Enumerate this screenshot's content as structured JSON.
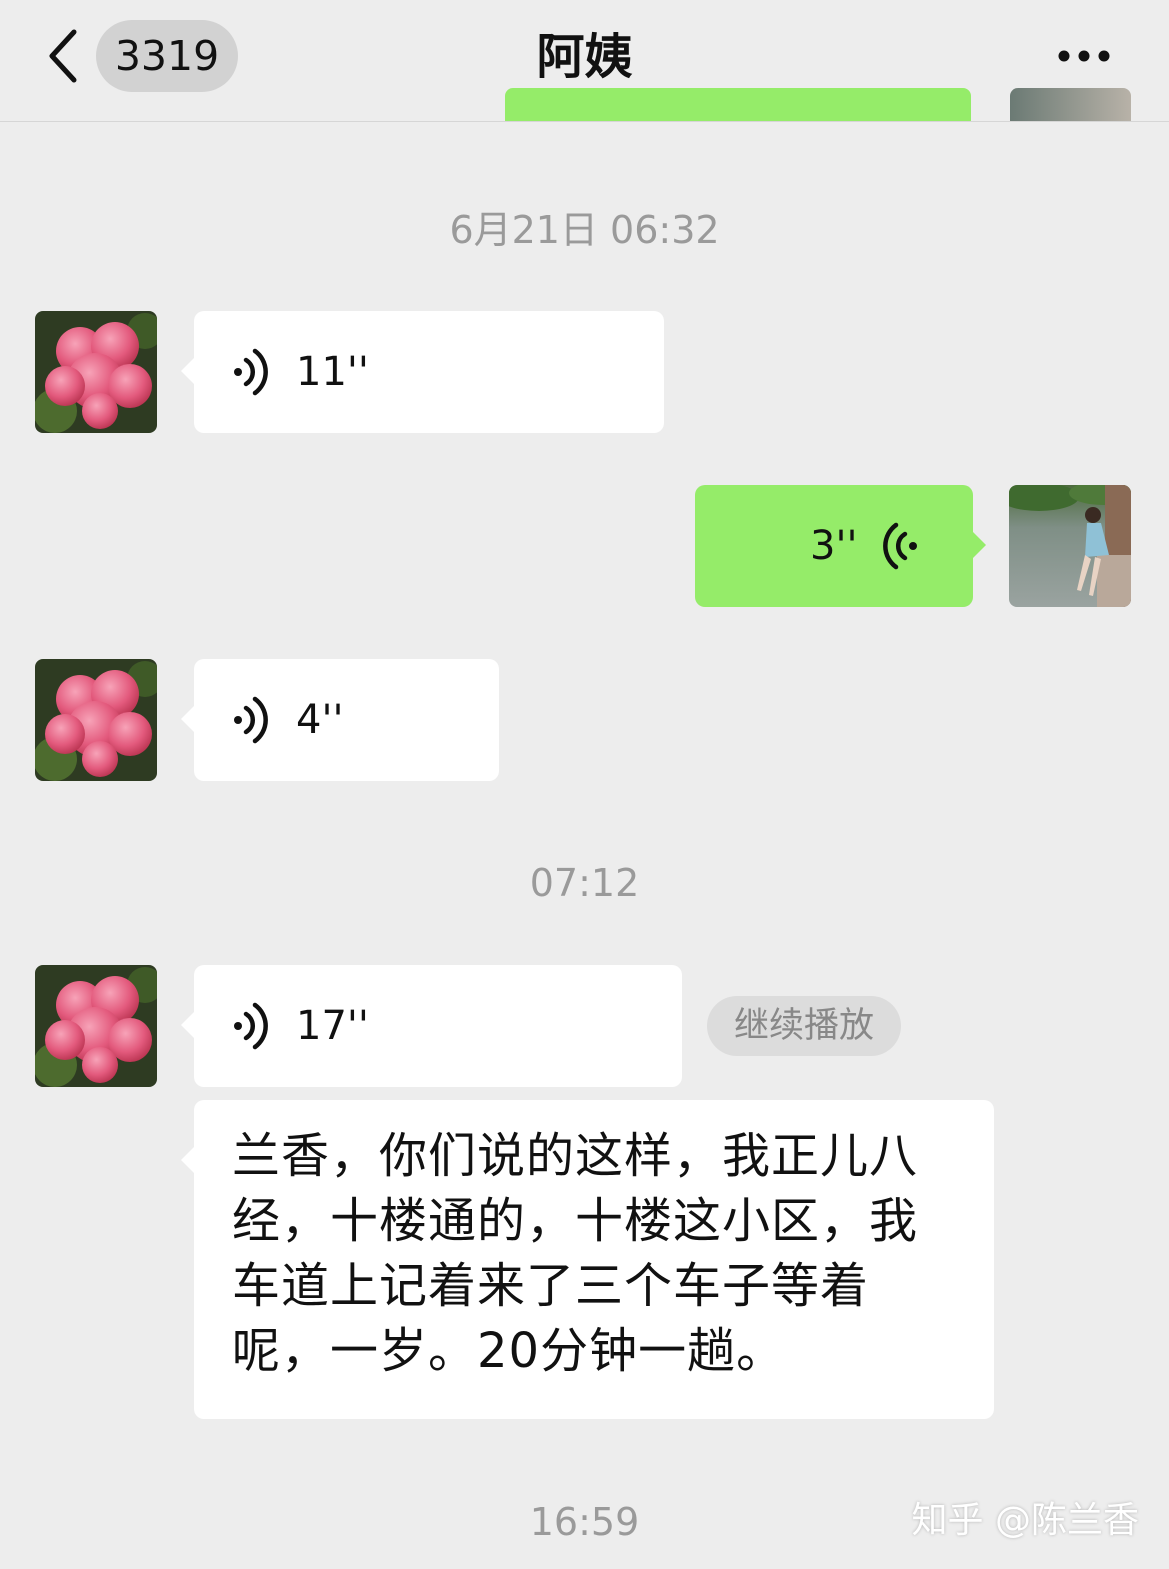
{
  "header": {
    "back_label": "3319",
    "title": "阿姨"
  },
  "messages": [
    {
      "type": "time",
      "text": "6月21日 06:32"
    },
    {
      "type": "voice",
      "side": "left",
      "duration": "11''"
    },
    {
      "type": "voice",
      "side": "right",
      "duration": "3''"
    },
    {
      "type": "voice",
      "side": "left",
      "duration": "4''"
    },
    {
      "type": "time",
      "text": "07:12"
    },
    {
      "type": "voice",
      "side": "left",
      "duration": "17''",
      "action_label": "继续播放"
    },
    {
      "type": "text",
      "side": "left",
      "lines": [
        "兰香，你们说的这样，我正儿八",
        "经，十楼通的，十楼这小区，我",
        "车道上记着来了三个车子等着",
        "呢，一岁。20分钟一趟。"
      ]
    },
    {
      "type": "time",
      "text": "16:59"
    }
  ],
  "watermark": "知乎 @陈兰香",
  "colors": {
    "background": "#ededed",
    "sent_bubble": "#95ec69",
    "received_bubble": "#ffffff",
    "timestamp": "#9a9a9a"
  },
  "icons": {
    "back": "chevron-left-icon",
    "more": "more-dots-icon",
    "voice": "voice-waves-icon",
    "avatar_left": "pink-flower-avatar",
    "avatar_right": "person-by-lake-avatar"
  }
}
